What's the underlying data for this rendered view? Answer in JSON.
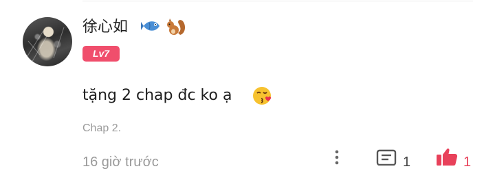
{
  "comment": {
    "username": "徐心如",
    "level": "Lv7",
    "text": "tặng 2 chap đc ko ạ",
    "chapter": "Chap 2.",
    "time": "16 giờ trước",
    "reply_count": "1",
    "like_count": "1"
  },
  "badges": [
    "fish-icon",
    "squirrel-icon"
  ],
  "emoji": "kissing-heart-icon",
  "colors": {
    "level_badge": "#f04e6c",
    "like": "#e8415a",
    "muted_text": "#9a9a9a"
  }
}
